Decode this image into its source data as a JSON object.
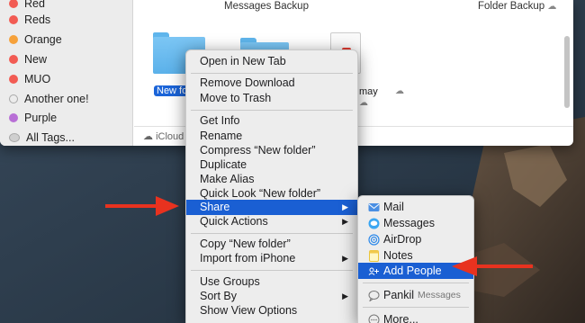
{
  "sidebar": {
    "tags": [
      {
        "label": "Red",
        "color": "#f25b53"
      },
      {
        "label": "Reds",
        "color": "#f25b53"
      },
      {
        "label": "Orange",
        "color": "#f6a13a"
      },
      {
        "label": "New",
        "color": "#f25b53"
      },
      {
        "label": "MUO",
        "color": "#f25b53"
      },
      {
        "label": "Another one!",
        "color": "hollow"
      },
      {
        "label": "Purple",
        "color": "#b86fd6"
      },
      {
        "label": "All Tags...",
        "color": "multi"
      }
    ]
  },
  "content": {
    "col1_title": "Messages Backup",
    "col2_title": "Folder Backup",
    "selected_file": "New fold",
    "partial_file": "may",
    "pathbar_text": "iCloud"
  },
  "context_menu": {
    "items": [
      {
        "label": "Open in New Tab"
      },
      {
        "label": "Remove Download"
      },
      {
        "label": "Move to Trash"
      },
      {
        "label": "Get Info"
      },
      {
        "label": "Rename"
      },
      {
        "label": "Compress “New folder”"
      },
      {
        "label": "Duplicate"
      },
      {
        "label": "Make Alias"
      },
      {
        "label": "Quick Look “New folder”"
      },
      {
        "label": "Share"
      },
      {
        "label": "Quick Actions"
      },
      {
        "label": "Copy “New folder”"
      },
      {
        "label": "Import from iPhone"
      },
      {
        "label": "Use Groups"
      },
      {
        "label": "Sort By"
      },
      {
        "label": "Show View Options"
      }
    ],
    "submenu_arrow": "▶"
  },
  "share_menu": {
    "items": [
      {
        "label": "Mail",
        "icon": "mail-icon"
      },
      {
        "label": "Messages",
        "icon": "messages-icon"
      },
      {
        "label": "AirDrop",
        "icon": "airdrop-icon"
      },
      {
        "label": "Notes",
        "icon": "notes-icon"
      },
      {
        "label": "Add People",
        "icon": "add-people-icon"
      },
      {
        "label": "Pankil",
        "note": "Messages",
        "icon": "contact-icon"
      },
      {
        "label": "More...",
        "icon": "more-icon"
      }
    ]
  },
  "colors": {
    "highlight": "#1a5fd3",
    "annotation_arrow": "#e8321f"
  }
}
